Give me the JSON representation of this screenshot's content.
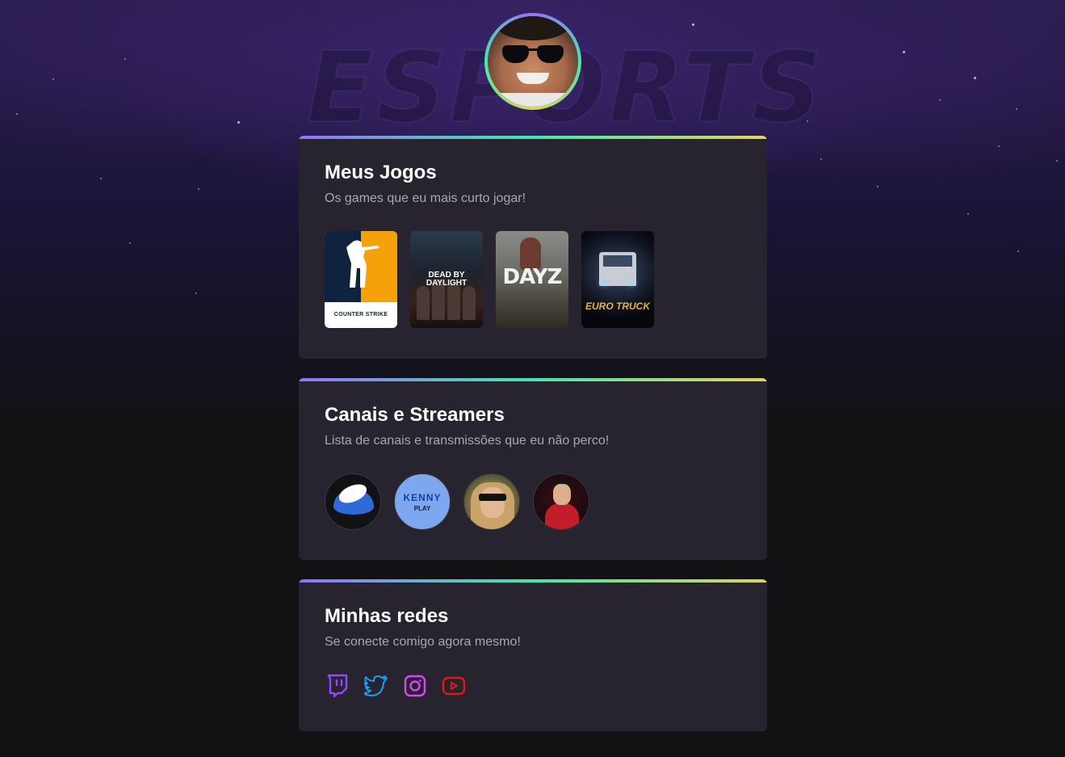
{
  "profile": {
    "avatar_alt": "Foto de perfil"
  },
  "background": {
    "watermark": "ESPORTS"
  },
  "sections": {
    "games": {
      "title": "Meus Jogos",
      "subtitle": "Os games que eu mais curto jogar!",
      "items": [
        {
          "name": "Counter-Strike",
          "cover_text": "COUNTER STRIKE"
        },
        {
          "name": "Dead by Daylight",
          "cover_text": "DEAD BY DAYLIGHT"
        },
        {
          "name": "DayZ",
          "cover_text": "DAYZ"
        },
        {
          "name": "Euro Truck Simulator",
          "cover_text": "EURO TRUCK"
        }
      ]
    },
    "streamers": {
      "title": "Canais e Streamers",
      "subtitle": "Lista de canais e transmissões que eu não perco!",
      "items": [
        {
          "icon": "winged-logo"
        },
        {
          "line1": "KENNY",
          "line2": "PLAY"
        },
        {
          "icon": "streamer-portrait"
        },
        {
          "icon": "streamer-portrait"
        }
      ]
    },
    "socials": {
      "title": "Minhas redes",
      "subtitle": "Se conecte comigo agora mesmo!",
      "items": [
        {
          "icon": "twitch-icon",
          "color": "#9147ff"
        },
        {
          "icon": "twitter-icon",
          "color": "#1d9bf0"
        },
        {
          "icon": "instagram-icon",
          "color": "#e040fb"
        },
        {
          "icon": "youtube-icon",
          "color": "#e01818"
        }
      ]
    }
  },
  "colors": {
    "card_bg": "#27242f",
    "page_bg": "#121214",
    "gradient": [
      "#9572fc",
      "#43e7ad",
      "#e2d45c"
    ]
  }
}
